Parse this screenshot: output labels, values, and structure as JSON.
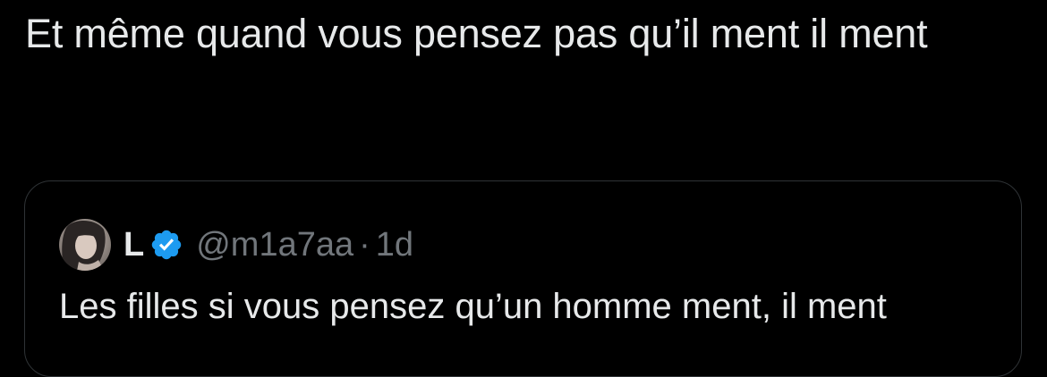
{
  "tweet": {
    "text": "Et même quand vous pensez pas qu’il ment il ment"
  },
  "quoted_tweet": {
    "author": {
      "display_name": "L",
      "handle": "@m1a7aa",
      "avatar_icon": "profile-photo",
      "verified_icon": "verified-badge-icon",
      "verified_color": "#1d9bf0"
    },
    "separator": "·",
    "timestamp": "1d",
    "text": "Les filles si vous pensez qu’un homme ment, il ment"
  },
  "colors": {
    "background": "#000000",
    "primary_text": "#e7e9ea",
    "secondary_text": "#71767b",
    "border": "#2f3336"
  }
}
